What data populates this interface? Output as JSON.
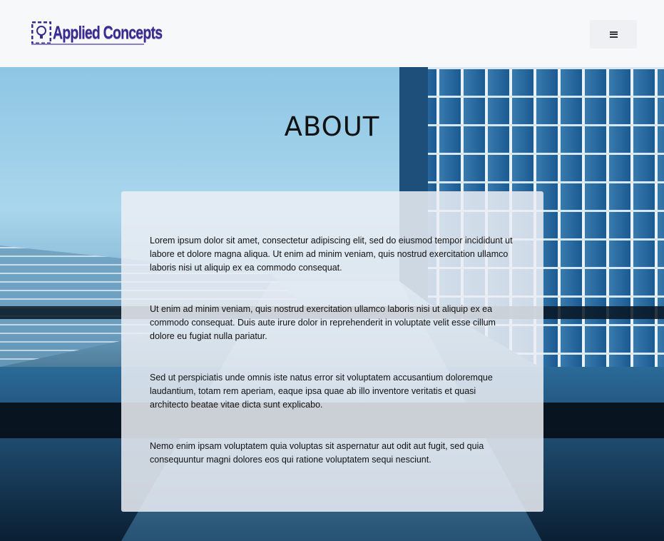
{
  "header": {
    "logo_text": "Applied Concepts",
    "menu_icon": "hamburger-menu-icon"
  },
  "hero": {
    "title": "ABOUT",
    "paragraphs": [
      "Lorem ipsum dolor sit amet, consectetur adipiscing elit, sed do eiusmod tempor incididunt ut labore et dolore magna aliqua. Ut enim ad minim veniam, quis nostrud exercitation ullamco laboris nisi ut aliquip ex ea commodo consequat.",
      "Ut enim ad minim veniam, quis nostrud exercitation ullamco laboris nisi ut aliquip ex ea commodo consequat. Duis aute irure dolor in reprehenderit in voluptate velit esse cillum dolore eu fugiat nulla pariatur.",
      "Sed ut perspiciatis unde omnis iste natus error sit voluptatem accusantium doloremque laudantium, totam rem aperiam, eaque ipsa quae ab illo inventore veritatis et quasi architecto beatae vitae dicta sunt explicabo.",
      "Nemo enim ipsam voluptatem quia voluptas sit aspernatur aut odit aut fugit, sed quia consequuntur magni dolores eos qui ratione voluptatem sequi nesciunt."
    ]
  },
  "colors": {
    "logo": "#3a2a8c",
    "card_background": "#ebeff5",
    "sky": "#a9d6ec",
    "glass": "#2f7db0"
  }
}
